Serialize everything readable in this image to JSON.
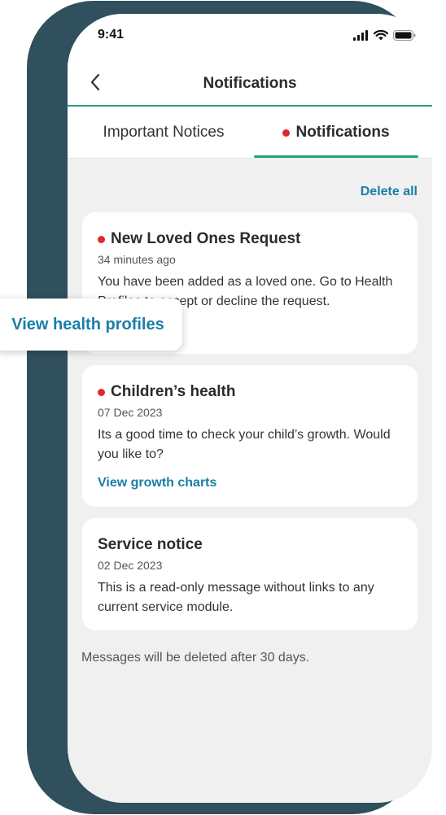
{
  "status_bar": {
    "time": "9:41"
  },
  "header": {
    "title": "Notifications"
  },
  "tabs": [
    {
      "label": "Important Notices",
      "active": false,
      "unread": false
    },
    {
      "label": "Notifications",
      "active": true,
      "unread": true
    }
  ],
  "actions": {
    "delete_all": "Delete all"
  },
  "notifications": [
    {
      "title": "New Loved Ones Request",
      "time": "34 minutes ago",
      "body": "You have been added as a loved one. Go to Health Profiles to accept or decline the request.",
      "link": "View health profiles",
      "unread": true
    },
    {
      "title": "Children’s health",
      "time": "07 Dec 2023",
      "body": "Its a good time to check your child’s growth. Would you like to?",
      "link": "View growth charts",
      "unread": true
    },
    {
      "title": "Service notice",
      "time": "02 Dec 2023",
      "body": "This is a read-only message without links to any current service module.",
      "unread": false
    }
  ],
  "footer": {
    "note": "Messages will be deleted after 30 days."
  },
  "colors": {
    "accent": "#21a07e",
    "link": "#1a7ea8",
    "unread_dot": "#e3262e",
    "frame": "#2f505c",
    "background": "#f0f0f0"
  },
  "icons": [
    "signal-icon",
    "wifi-icon",
    "battery-icon",
    "back-chevron-icon",
    "unread-dot-icon"
  ]
}
